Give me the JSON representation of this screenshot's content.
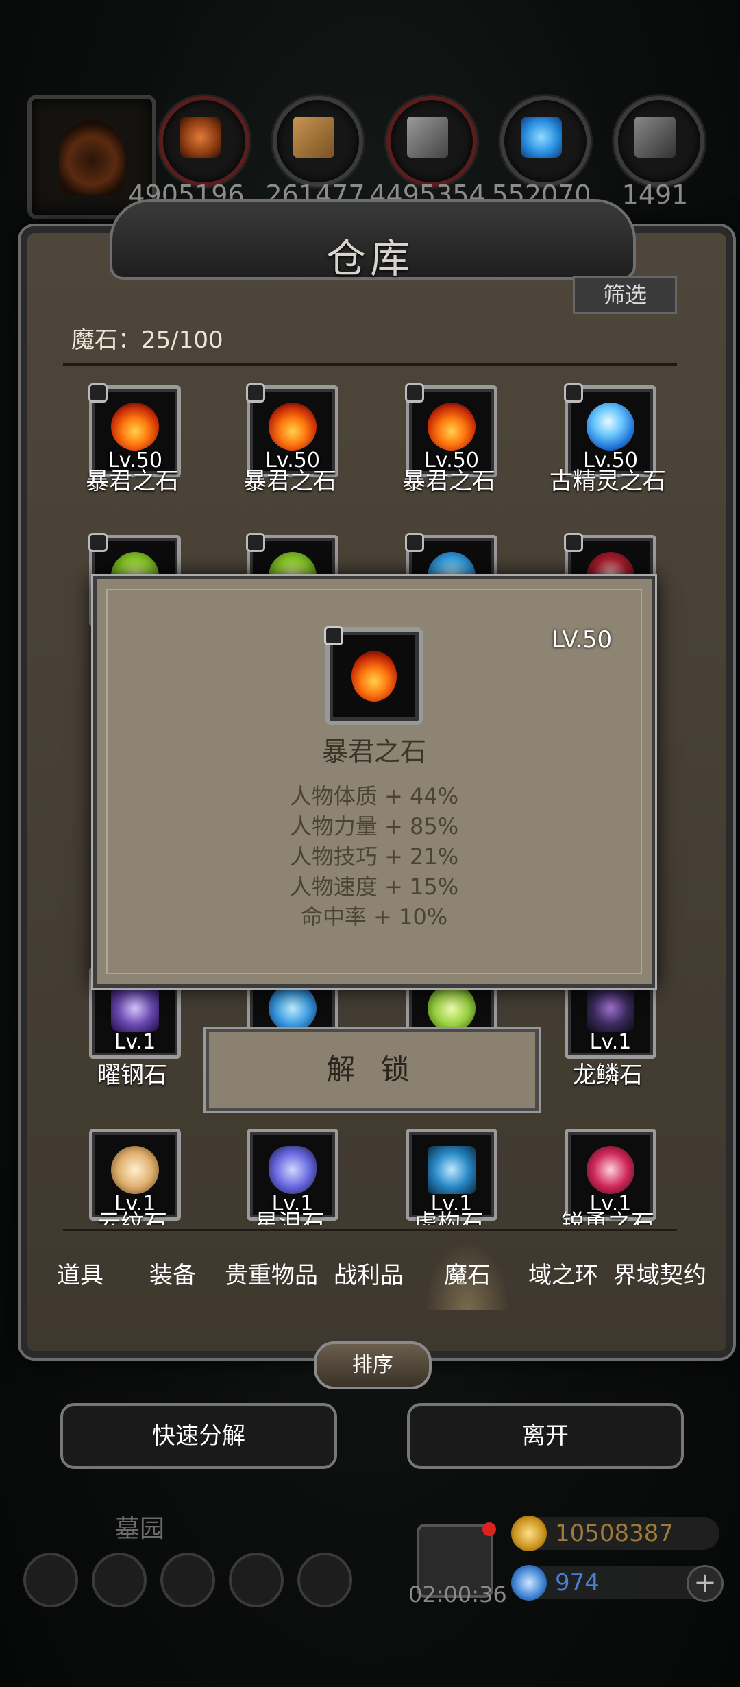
{
  "resources": [
    {
      "name": "resource-meat",
      "value": "4905196"
    },
    {
      "name": "resource-wood",
      "value": "261477"
    },
    {
      "name": "resource-iron",
      "value": "4495354"
    },
    {
      "name": "resource-crystal",
      "value": "552070"
    },
    {
      "name": "resource-stone",
      "value": "1491"
    }
  ],
  "panel": {
    "title": "仓库",
    "filter_label": "筛选",
    "count_label": "魔石：25/100"
  },
  "items_row1": [
    {
      "lv": "Lv.50",
      "name": "暴君之石"
    },
    {
      "lv": "Lv.50",
      "name": "暴君之石"
    },
    {
      "lv": "Lv.50",
      "name": "暴君之石"
    },
    {
      "lv": "Lv.50",
      "name": "古精灵之石"
    }
  ],
  "items_row_bottom": [
    {
      "lv": "Lv.1",
      "name": "曜钢石"
    },
    {
      "lv": "Lv.1",
      "name": "龙鳞石"
    }
  ],
  "items_row_last": [
    {
      "lv": "Lv.1",
      "name": "云纹石"
    },
    {
      "lv": "Lv.1",
      "name": "星泪石"
    },
    {
      "lv": "Lv.1",
      "name": "虚构石"
    },
    {
      "lv": "Lv.1",
      "name": "锐勇之石"
    }
  ],
  "popup": {
    "level": "LV.50",
    "name": "暴君之石",
    "stats": [
      "人物体质 + 44%",
      "人物力量 + 85%",
      "人物技巧 + 21%",
      "人物速度 + 15%",
      "命中率 + 10%"
    ],
    "unlock_label": "解 锁"
  },
  "tabs": [
    "道具",
    "装备",
    "贵重物品",
    "战利品",
    "魔石",
    "域之环",
    "界域契约"
  ],
  "active_tab": "魔石",
  "sort_label": "排序",
  "quick_decompose_label": "快速分解",
  "leave_label": "离开",
  "location_label": "墓园",
  "timer": "02:00:36",
  "currency": {
    "gold": "10508387",
    "gems": "974"
  },
  "colors": {
    "panel": "#4e463a",
    "popup": "#8d8473",
    "gold_text": "#a07a3a",
    "gem_text": "#4a7fd0"
  }
}
